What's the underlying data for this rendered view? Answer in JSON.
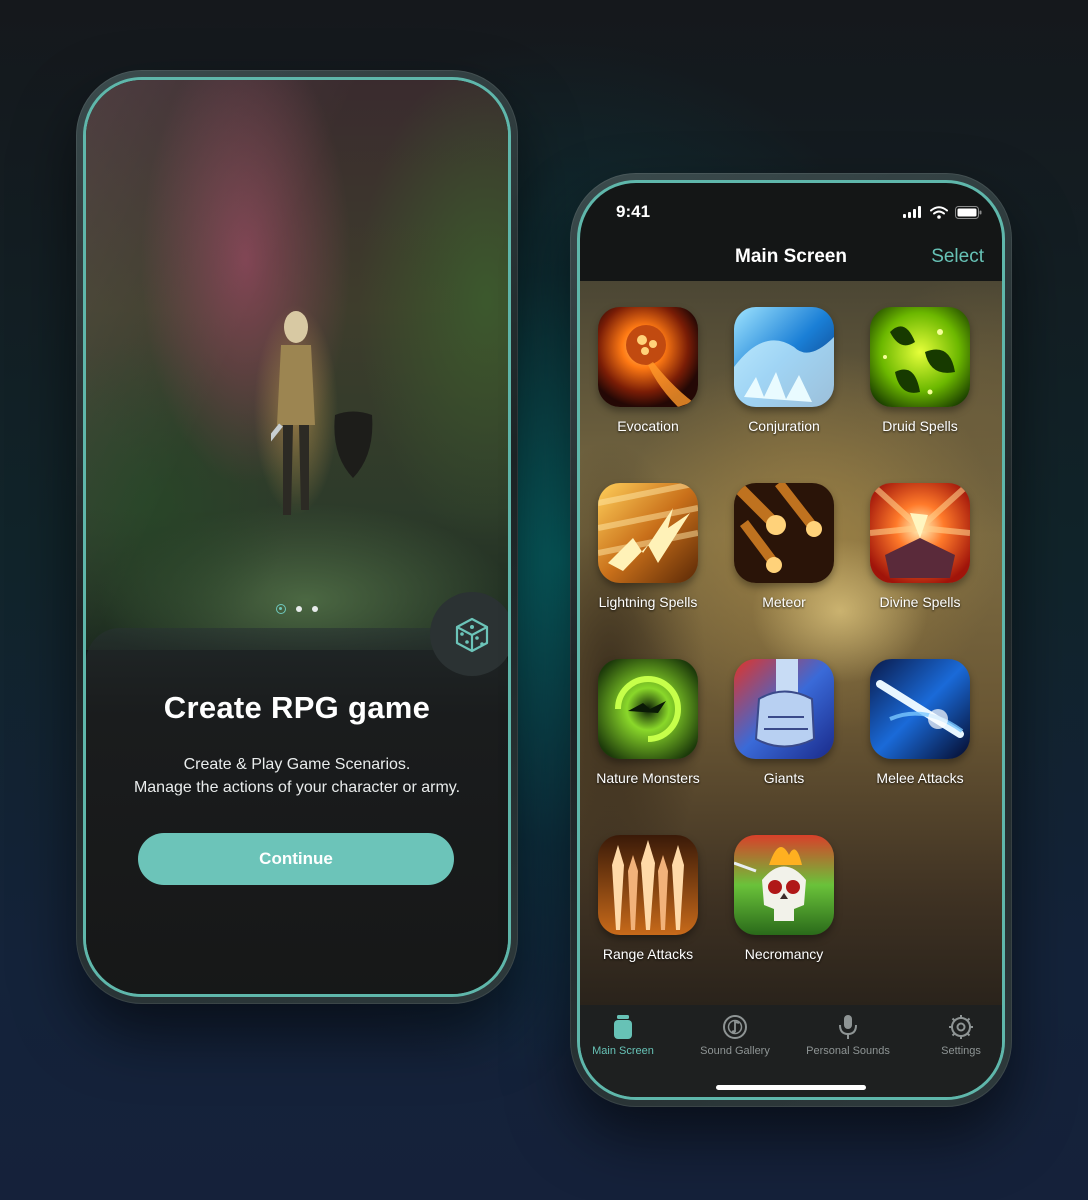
{
  "onboarding": {
    "title": "Create RPG game",
    "subtitle_line1": "Create & Play Game Scenarios.",
    "subtitle_line2": "Manage the actions of your character or army.",
    "continue_label": "Continue",
    "page_dots": 3,
    "active_dot": 0
  },
  "main": {
    "status_time": "9:41",
    "nav_title": "Main Screen",
    "nav_action": "Select",
    "categories": [
      {
        "label": "Evocation",
        "icon": "fireball-icon"
      },
      {
        "label": "Conjuration",
        "icon": "ice-wave-icon"
      },
      {
        "label": "Druid Spells",
        "icon": "leaves-icon"
      },
      {
        "label": "Lightning Spells",
        "icon": "lightning-icon"
      },
      {
        "label": "Meteor",
        "icon": "meteor-icon"
      },
      {
        "label": "Divine Spells",
        "icon": "divine-burst-icon"
      },
      {
        "label": "Nature Monsters",
        "icon": "vortex-icon"
      },
      {
        "label": "Giants",
        "icon": "giant-fist-icon"
      },
      {
        "label": "Melee Attacks",
        "icon": "blade-slash-icon"
      },
      {
        "label": "Range Attacks",
        "icon": "arrows-icon"
      },
      {
        "label": "Necromancy",
        "icon": "skull-icon"
      }
    ],
    "tabs": [
      {
        "label": "Main Screen",
        "icon": "jar-icon",
        "active": true
      },
      {
        "label": "Sound Gallery",
        "icon": "vinyl-note-icon",
        "active": false
      },
      {
        "label": "Personal Sounds",
        "icon": "microphone-icon",
        "active": false
      },
      {
        "label": "Settings",
        "icon": "gear-icon",
        "active": false
      }
    ]
  },
  "colors": {
    "accent": "#6cc4b9",
    "frame": "#5fb7ab",
    "tab_inactive": "#8e9494"
  }
}
